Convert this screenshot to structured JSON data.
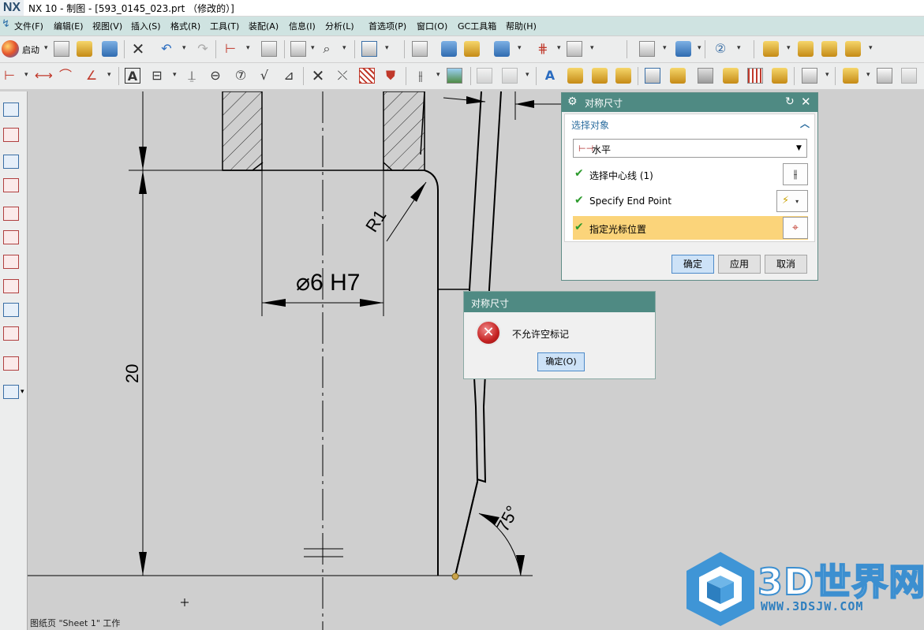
{
  "window": {
    "logo": "NX",
    "title": "NX 10 - 制图 - [593_0145_023.prt （修改的）]"
  },
  "menu": [
    "文件(F)",
    "编辑(E)",
    "视图(V)",
    "插入(S)",
    "格式(R)",
    "工具(T)",
    "装配(A)",
    "信息(I)",
    "分析(L)",
    "首选项(P)",
    "窗口(O)",
    "GC工具箱",
    "帮助(H)"
  ],
  "toolbar": {
    "start_label": "启动"
  },
  "drawing": {
    "dim_hole": "⌀6 H7",
    "dim_height": "20",
    "dim_radius": "R1",
    "dim_angle": "75°"
  },
  "status": {
    "text": "图纸页 \"Sheet 1\" 工作"
  },
  "watermark": {
    "brand": "3D世界网",
    "url": "WWW.3DSJW.COM"
  },
  "dialog": {
    "title": "对称尺寸",
    "section": "选择对象",
    "method": "水平",
    "rows": [
      {
        "label": "选择中心线 (1)",
        "checked": true
      },
      {
        "label": "Specify End Point",
        "checked": true
      },
      {
        "label": "指定光标位置",
        "checked": true
      }
    ],
    "ok": "确定",
    "apply": "应用",
    "cancel": "取消"
  },
  "error_dialog": {
    "title": "对称尺寸",
    "message": "不允许空标记",
    "ok": "确定(O)"
  }
}
